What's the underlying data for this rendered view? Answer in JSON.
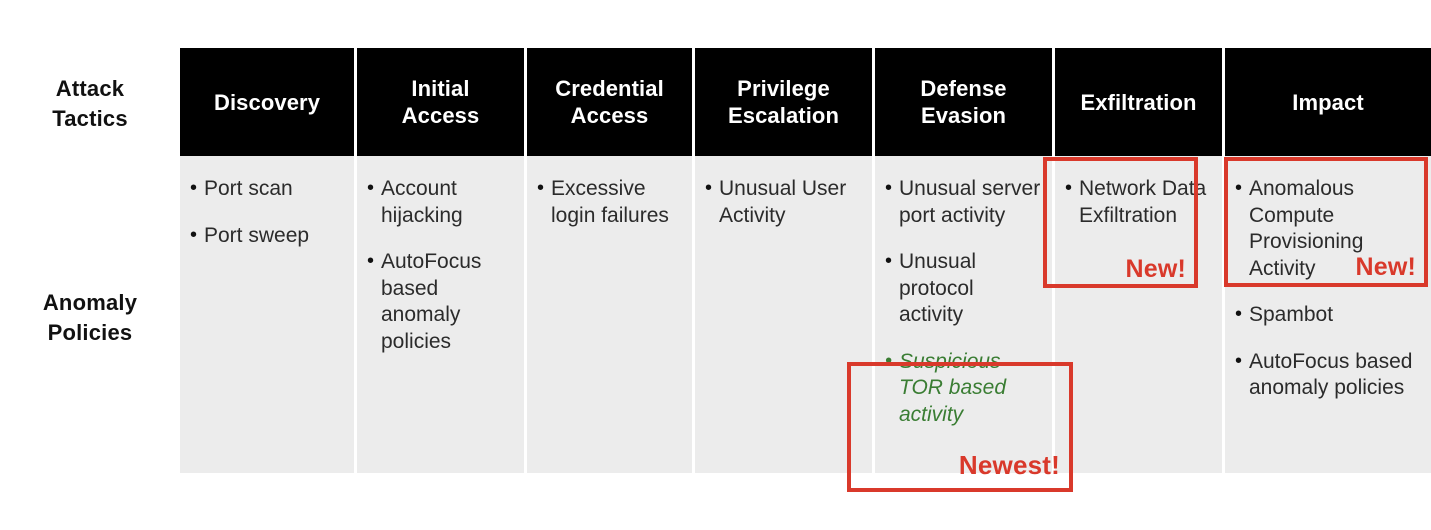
{
  "row_labels": {
    "attack_tactics": [
      "Attack",
      "Tactics"
    ],
    "anomaly_policies": [
      "Anomaly",
      "Policies"
    ]
  },
  "columns": [
    {
      "id": "discovery",
      "header": [
        "Discovery"
      ],
      "items": [
        {
          "text": "Port scan",
          "style": "normal"
        },
        {
          "text": "Port sweep",
          "style": "normal"
        }
      ]
    },
    {
      "id": "initial-access",
      "header": [
        "Initial",
        "Access"
      ],
      "items": [
        {
          "text": "Account hijacking",
          "style": "normal"
        },
        {
          "text": "AutoFocus based anomaly policies",
          "style": "normal"
        }
      ]
    },
    {
      "id": "credential-access",
      "header": [
        "Credential",
        "Access"
      ],
      "items": [
        {
          "text": "Excessive login failures",
          "style": "normal"
        }
      ]
    },
    {
      "id": "privilege-escalation",
      "header": [
        "Privilege",
        "Escalation"
      ],
      "items": [
        {
          "text": "Unusual User Activity",
          "style": "normal"
        }
      ]
    },
    {
      "id": "defense-evasion",
      "header": [
        "Defense",
        "Evasion"
      ],
      "items": [
        {
          "text": "Unusual server port activity",
          "style": "normal"
        },
        {
          "text": "Unusual protocol activity",
          "style": "normal"
        },
        {
          "text": "Suspicious TOR based activity",
          "style": "green-italic"
        }
      ]
    },
    {
      "id": "exfiltration",
      "header": [
        "Exfiltration"
      ],
      "items": [
        {
          "text": "Network Data Exfiltration",
          "style": "normal"
        }
      ]
    },
    {
      "id": "impact",
      "header": [
        "Impact"
      ],
      "items": [
        {
          "text": "Anomalous Compute Provisioning Activity",
          "style": "normal"
        },
        {
          "text": "Spambot",
          "style": "normal"
        },
        {
          "text": "AutoFocus based anomaly policies",
          "style": "normal"
        }
      ]
    }
  ],
  "highlights": {
    "exfiltration_tag": "New!",
    "impact_tag": "New!",
    "defense_evasion_tag": "Newest!"
  },
  "colors": {
    "header_bg": "#000000",
    "header_text": "#ffffff",
    "cell_bg": "#ececec",
    "highlight": "#d9392b",
    "accent_green": "#3a7d33",
    "body_text": "#2b2b2b"
  }
}
